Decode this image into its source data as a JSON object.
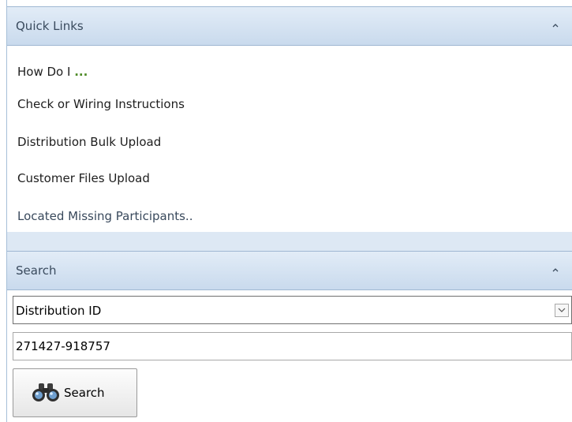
{
  "quick_links": {
    "title": "Quick Links",
    "collapse_icon": "chevron-up-icon",
    "items": [
      {
        "label": "How Do I ",
        "suffix": "..."
      },
      {
        "label": "Check or Wiring Instructions"
      },
      {
        "label": "Distribution Bulk Upload"
      },
      {
        "label": "Customer Files Upload"
      },
      {
        "label": "Located Missing Participants.."
      }
    ]
  },
  "search": {
    "title": "Search",
    "collapse_icon": "chevron-up-icon",
    "type_select": {
      "value": "Distribution ID"
    },
    "query_input": {
      "value": "271427-918757"
    },
    "button": {
      "label": "Search",
      "icon": "binoculars-icon"
    }
  },
  "colors": {
    "header_gradient_top": "#e2ecf7",
    "header_gradient_bottom": "#c9daed",
    "header_border": "#9fb7d2",
    "band": "#dde8f4",
    "accent_dots": "#4d8a26"
  }
}
